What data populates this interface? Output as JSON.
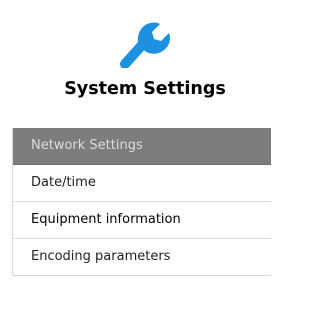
{
  "header": {
    "icon": "wrench-icon",
    "icon_color": "#1e90e0",
    "title": "System Settings"
  },
  "menu": {
    "items": [
      {
        "label": "Network Settings",
        "active": true
      },
      {
        "label": "Date/time",
        "active": false
      },
      {
        "label": "Equipment information",
        "active": false
      },
      {
        "label": "Encoding parameters",
        "active": false
      }
    ],
    "active_bg": "#7d7d7d"
  }
}
